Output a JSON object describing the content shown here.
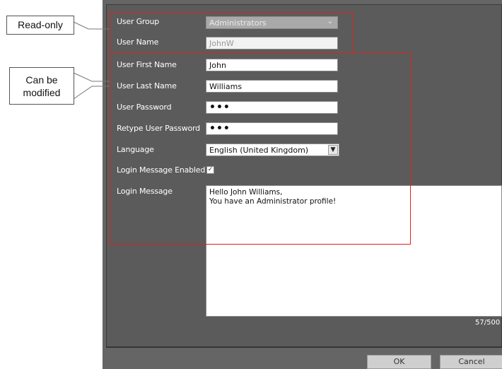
{
  "callouts": {
    "read_only": "Read-only",
    "modifiable_line1": "Can be",
    "modifiable_line2": "modified"
  },
  "form": {
    "user_group": {
      "label": "User Group",
      "value": "Administrators"
    },
    "user_name": {
      "label": "User Name",
      "value": "JohnW"
    },
    "first_name": {
      "label": "User First Name",
      "value": "John"
    },
    "last_name": {
      "label": "User Last Name",
      "value": "Williams"
    },
    "password": {
      "label": "User Password",
      "value": "•••"
    },
    "retype_password": {
      "label": "Retype User Password",
      "value": "•••"
    },
    "language": {
      "label": "Language",
      "value": "English (United Kingdom)"
    },
    "login_message_enabled": {
      "label": "Login Message Enabled",
      "checked": true,
      "check_glyph": "✓"
    },
    "login_message": {
      "label": "Login Message",
      "value": "Hello John Williams,\nYou have an Administrator profile!",
      "counter": "57/500"
    }
  },
  "buttons": {
    "ok": "OK",
    "cancel": "Cancel"
  },
  "icons": {
    "dropdown": "chevron-down-icon",
    "combo": "dropdown-button-icon",
    "check": "checkmark-icon"
  },
  "colors": {
    "dialog_bg": "#656565",
    "panel_bg": "#5b5b5b",
    "highlight": "#e0201b"
  }
}
